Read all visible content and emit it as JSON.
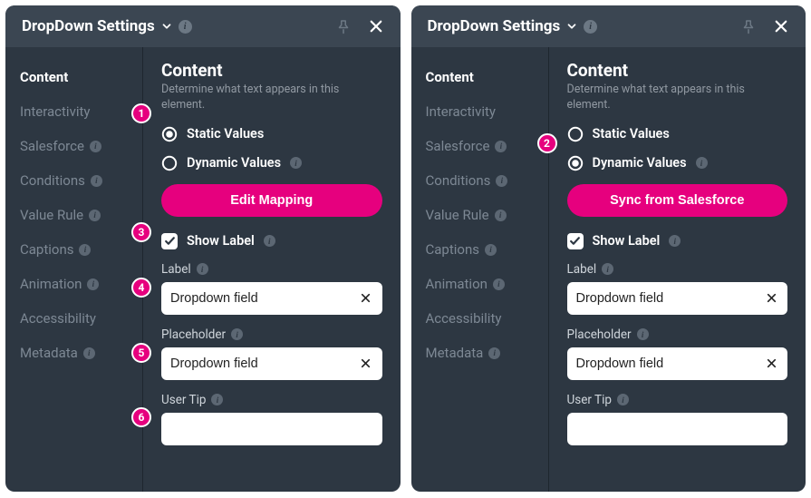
{
  "panel": {
    "title": "DropDown Settings"
  },
  "sidebar": {
    "items": [
      {
        "label": "Content",
        "info": false,
        "active": true
      },
      {
        "label": "Interactivity",
        "info": false,
        "active": false
      },
      {
        "label": "Salesforce",
        "info": true,
        "active": false
      },
      {
        "label": "Conditions",
        "info": true,
        "active": false
      },
      {
        "label": "Value Rule",
        "info": true,
        "active": false
      },
      {
        "label": "Captions",
        "info": true,
        "active": false
      },
      {
        "label": "Animation",
        "info": true,
        "active": false
      },
      {
        "label": "Accessibility",
        "info": false,
        "active": false
      },
      {
        "label": "Metadata",
        "info": true,
        "active": false
      }
    ]
  },
  "content": {
    "heading": "Content",
    "desc": "Determine what text appears in this element.",
    "radio_static": "Static Values",
    "radio_dynamic": "Dynamic Values",
    "button_left": "Edit Mapping",
    "button_right": "Sync from Salesforce",
    "show_label": "Show Label",
    "label_field": {
      "label": "Label",
      "value": "Dropdown field"
    },
    "placeholder_field": {
      "label": "Placeholder",
      "value": "Dropdown field"
    },
    "usertip_field": {
      "label": "User Tip",
      "value": ""
    }
  },
  "badges": [
    "1",
    "2",
    "3",
    "4",
    "5",
    "6"
  ]
}
